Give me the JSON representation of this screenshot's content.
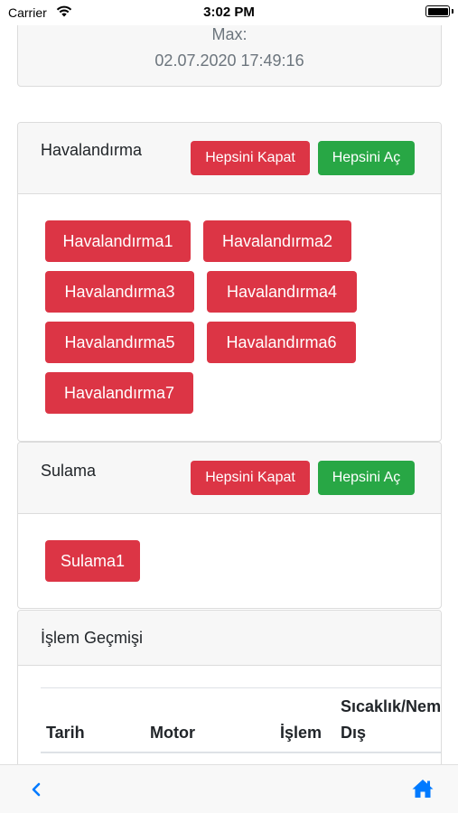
{
  "status_bar": {
    "carrier": "Carrier",
    "time": "3:02 PM"
  },
  "summary": {
    "max_label": "Max:",
    "max_date": "02.07.2020 17:49:16"
  },
  "ventilation": {
    "title": "Havalandırma",
    "close_all": "Hepsini Kapat",
    "open_all": "Hepsini Aç",
    "devices": [
      "Havalandırma1",
      "Havalandırma2",
      "Havalandırma3",
      "Havalandırma4",
      "Havalandırma5",
      "Havalandırma6",
      "Havalandırma7"
    ]
  },
  "irrigation": {
    "title": "Sulama",
    "close_all": "Hepsini Kapat",
    "open_all": "Hepsini Aç",
    "devices": [
      "Sulama1"
    ]
  },
  "history": {
    "title": "İşlem Geçmişi",
    "columns": [
      "Tarih",
      "Motor",
      "İşlem",
      "Sıcaklık/Nem",
      "Dış"
    ]
  },
  "colors": {
    "danger": "#dc3545",
    "success": "#28a745",
    "accent": "#007aff"
  },
  "icons": {
    "back": "chevron-left-icon",
    "home": "home-icon",
    "wifi": "wifi-icon",
    "battery": "battery-icon"
  }
}
